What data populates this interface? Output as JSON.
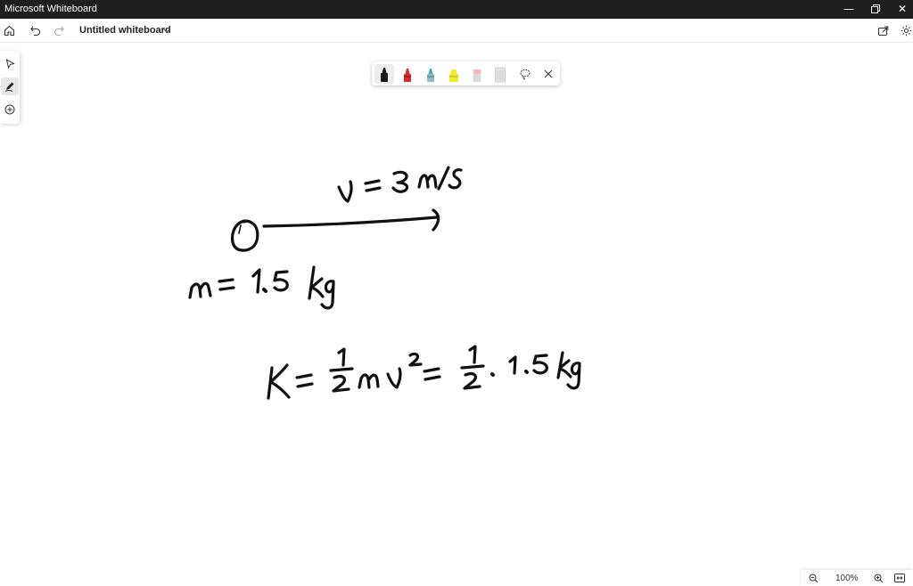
{
  "window": {
    "title": "Microsoft Whiteboard",
    "controls": [
      "minimize-icon",
      "restore-icon",
      "close-icon"
    ]
  },
  "appbar": {
    "board_title": "Untitled whiteboard",
    "icons": [
      "home-icon",
      "undo-icon",
      "redo-icon",
      "chevron-down-icon",
      "share-icon",
      "settings-icon"
    ]
  },
  "left_rail": {
    "tools": [
      "select-tool-icon",
      "ink-tool-icon",
      "add-icon"
    ],
    "active": "ink-tool-icon"
  },
  "pen_tray": {
    "pens": [
      {
        "name": "black-pen",
        "color": "#1a1a1a"
      },
      {
        "name": "red-pen",
        "color": "#d62b2b"
      },
      {
        "name": "teal-pen",
        "color": "#4aa6b8"
      },
      {
        "name": "yellow-highlighter",
        "color": "#f2ea2e"
      },
      {
        "name": "pink-eraser",
        "color": "#f2b9bf"
      },
      {
        "name": "ruler",
        "color": "#cfcfcf"
      }
    ],
    "active": "black-pen",
    "extra_icons": [
      "lasso-icon",
      "close-icon"
    ]
  },
  "ink": {
    "velocity": "v = 3 m/s",
    "mass": "m = 1.5 kg",
    "energy": "K = 1/2 m v^2 = 1/2 · 1.5 kg"
  },
  "zoom": {
    "percent": "100%",
    "icons": [
      "zoom-out-icon",
      "zoom-in-icon",
      "fit-to-screen-icon"
    ]
  }
}
